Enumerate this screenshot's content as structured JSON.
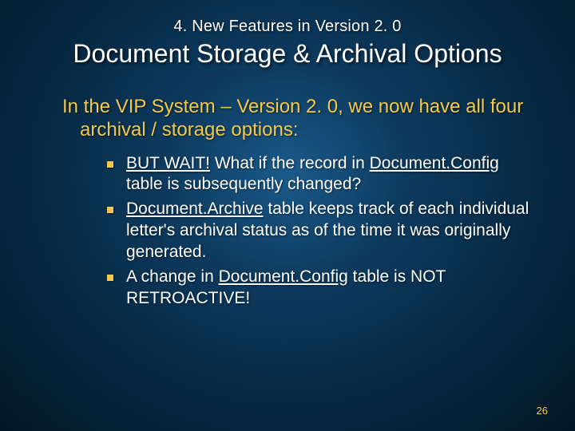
{
  "slide": {
    "pretitle": "4. New Features in Version 2. 0",
    "title": "Document Storage & Archival Options",
    "lead": "In the VIP System – Version 2. 0, we now have all four archival / storage options:",
    "bullets": [
      {
        "prefix_under": "BUT WAIT!",
        "mid_plain": " What if the record in ",
        "term_under": "Document.Config",
        "after": " table is subsequently changed?"
      },
      {
        "prefix_under": "",
        "mid_plain": "",
        "term_under": "Document.Archive",
        "after": " table keeps track of each individual letter's archival status as of the time it was originally generated."
      },
      {
        "prefix_under": "",
        "mid_plain": "A change in ",
        "term_under": "Document.Config",
        "after": " table is NOT RETROACTIVE!"
      }
    ],
    "page_number": "26"
  }
}
